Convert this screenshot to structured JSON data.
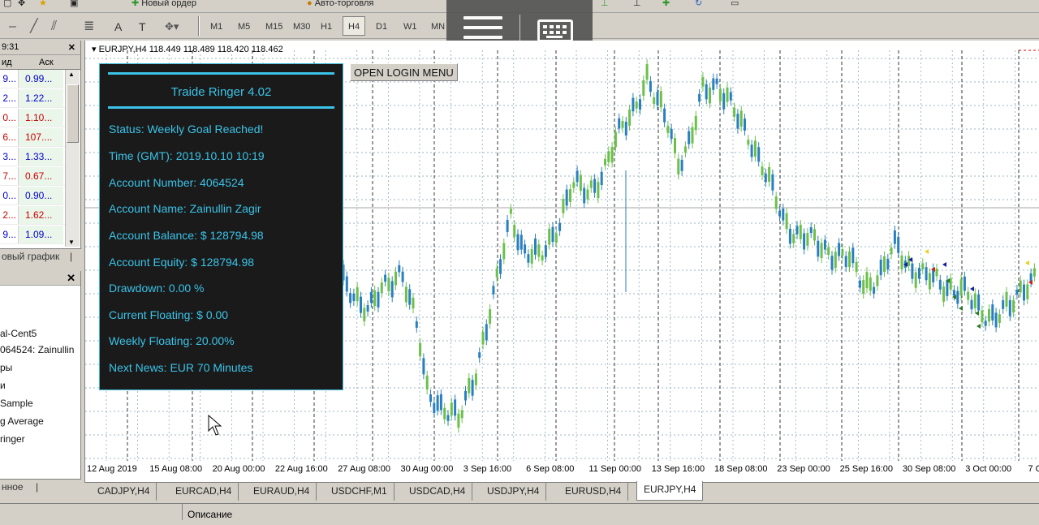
{
  "toolbar1": {
    "new_order": "Новый ордер",
    "auto_trading": "Авто-торговля"
  },
  "toolbar2": {
    "timeframes": [
      "M1",
      "M5",
      "M15",
      "M30",
      "H1",
      "H4",
      "D1",
      "W1",
      "MN"
    ],
    "active_timeframe": "H4",
    "text_tool": "A",
    "label_tool": "T"
  },
  "market_watch": {
    "time": "9:31",
    "col_bid": "ид",
    "col_ask": "Аск",
    "rows": [
      {
        "bid": "9...",
        "ask": "0.99...",
        "color": "#0000cc"
      },
      {
        "bid": "2...",
        "ask": "1.22...",
        "color": "#0000cc"
      },
      {
        "bid": "0...",
        "ask": "1.10...",
        "color": "#cc0000"
      },
      {
        "bid": "6...",
        "ask": "107....",
        "color": "#cc0000"
      },
      {
        "bid": "3...",
        "ask": "1.33...",
        "color": "#0000cc"
      },
      {
        "bid": "7...",
        "ask": "0.67...",
        "color": "#cc0000"
      },
      {
        "bid": "0...",
        "ask": "0.90...",
        "color": "#0000cc"
      },
      {
        "bid": "2...",
        "ask": "1.62...",
        "color": "#cc0000"
      },
      {
        "bid": "9...",
        "ask": "1.09...",
        "color": "#0000cc"
      }
    ],
    "tab_label": "овый график"
  },
  "navigator": {
    "items": [
      "al-Cent5",
      "064524: Zainullin",
      "ры",
      "и",
      "Sample",
      "g Average",
      "ringer"
    ],
    "tab_label": "нное"
  },
  "chart": {
    "title": "EURJPY,H4  118.449 118.489 118.420 118.462",
    "login_button": "OPEN LOGIN MENU",
    "time_labels": [
      "12 Aug 2019",
      "15 Aug 08:00",
      "20 Aug 00:00",
      "22 Aug 16:00",
      "27 Aug 08:00",
      "30 Aug 00:00",
      "3 Sep 16:00",
      "6 Sep 08:00",
      "11 Sep 00:00",
      "13 Sep 16:00",
      "18 Sep 08:00",
      "23 Sep 00:00",
      "25 Sep 16:00",
      "30 Sep 08:00",
      "3 Oct 00:00",
      "7 O"
    ]
  },
  "panel": {
    "title": "Traide Ringer 4.02",
    "status": "Status: Weekly Goal Reached!",
    "time": "Time (GMT): 2019.10.10 10:19",
    "account_number": "Account Number: 4064524",
    "account_name": "Account Name: Zainullin Zagir",
    "balance": "Account Balance: $ 128794.98",
    "equity": "Account Equity: $ 128794.98",
    "drawdown": "Drawdown: 0.00 %",
    "floating": "Current Floating: $ 0.00",
    "weekly_floating": "Weekly Floating: 20.00%",
    "next_news": "Next News: EUR 70 Minutes"
  },
  "chart_tabs": [
    "CADJPY,H4",
    "EURCAD,H4",
    "EURAUD,H4",
    "USDCHF,M1",
    "USDCAD,H4",
    "USDJPY,H4",
    "EURUSD,H4",
    "EURJPY,H4"
  ],
  "active_chart_tab": "EURJPY,H4",
  "statusbar": {
    "description": "Описание"
  },
  "colors": {
    "bull": "#6cc04a",
    "bear": "#2a7fc0",
    "panel_text": "#3bc3e8",
    "grid": "#7f9fb0"
  },
  "icons": [
    "hamburger-menu-icon",
    "keyboard-icon",
    "close-icon",
    "mouse-pointer-icon",
    "chevron-down-icon"
  ]
}
